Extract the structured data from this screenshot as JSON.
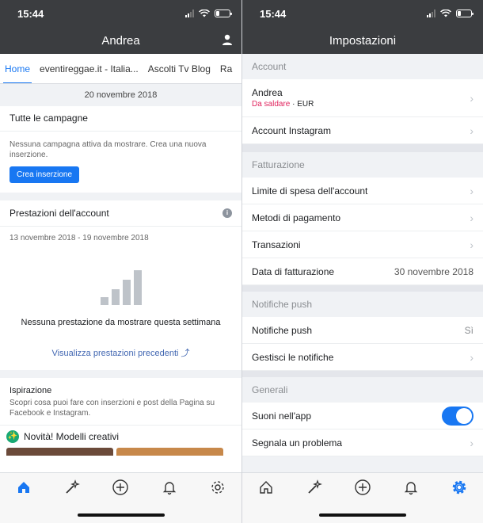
{
  "left": {
    "status": {
      "time": "15:44"
    },
    "header": {
      "title": "Andrea"
    },
    "tabs": [
      "Home",
      "eventireggae.it - Italia...",
      "Ascolti Tv Blog",
      "Ra"
    ],
    "date_bar": "20 novembre 2018",
    "campaigns": {
      "title": "Tutte le campagne",
      "empty_text": "Nessuna campagna attiva da mostrare. Crea una nuova inserzione.",
      "button": "Crea inserzione"
    },
    "performance": {
      "title": "Prestazioni dell'account",
      "range": "13 novembre 2018 - 19 novembre 2018",
      "empty_text": "Nessuna prestazione da mostrare questa settimana",
      "link": "Visualizza prestazioni precedenti",
      "info_icon": "i"
    },
    "inspiration": {
      "title": "Ispirazione",
      "text": "Scopri cosa puoi fare con inserzioni e post della Pagina su Facebook e Instagram.",
      "promo": "Novità! Modelli creativi"
    },
    "tabbar": [
      "home-icon",
      "magic-wand-icon",
      "plus-icon",
      "bell-icon",
      "gear-icon"
    ],
    "active_tab_color": "#1877f2"
  },
  "right": {
    "status": {
      "time": "15:44"
    },
    "header": {
      "title": "Impostazioni"
    },
    "sections": {
      "account": {
        "heading": "Account",
        "name": "Andrea",
        "status": "Da saldare",
        "currency": "· EUR",
        "instagram": "Account Instagram"
      },
      "billing": {
        "heading": "Fatturazione",
        "spend_limit": "Limite di spesa dell'account",
        "payment_methods": "Metodi di pagamento",
        "transactions": "Transazioni",
        "billing_date_label": "Data di fatturazione",
        "billing_date_value": "30 novembre 2018"
      },
      "push": {
        "heading": "Notifiche push",
        "push_label": "Notifiche push",
        "push_value": "Sì",
        "manage": "Gestisci le notifiche"
      },
      "general": {
        "heading": "Generali",
        "sounds": "Suoni nell'app",
        "report": "Segnala un problema"
      }
    },
    "accent_color": "#1877f2",
    "warning_color": "#e0245e"
  }
}
